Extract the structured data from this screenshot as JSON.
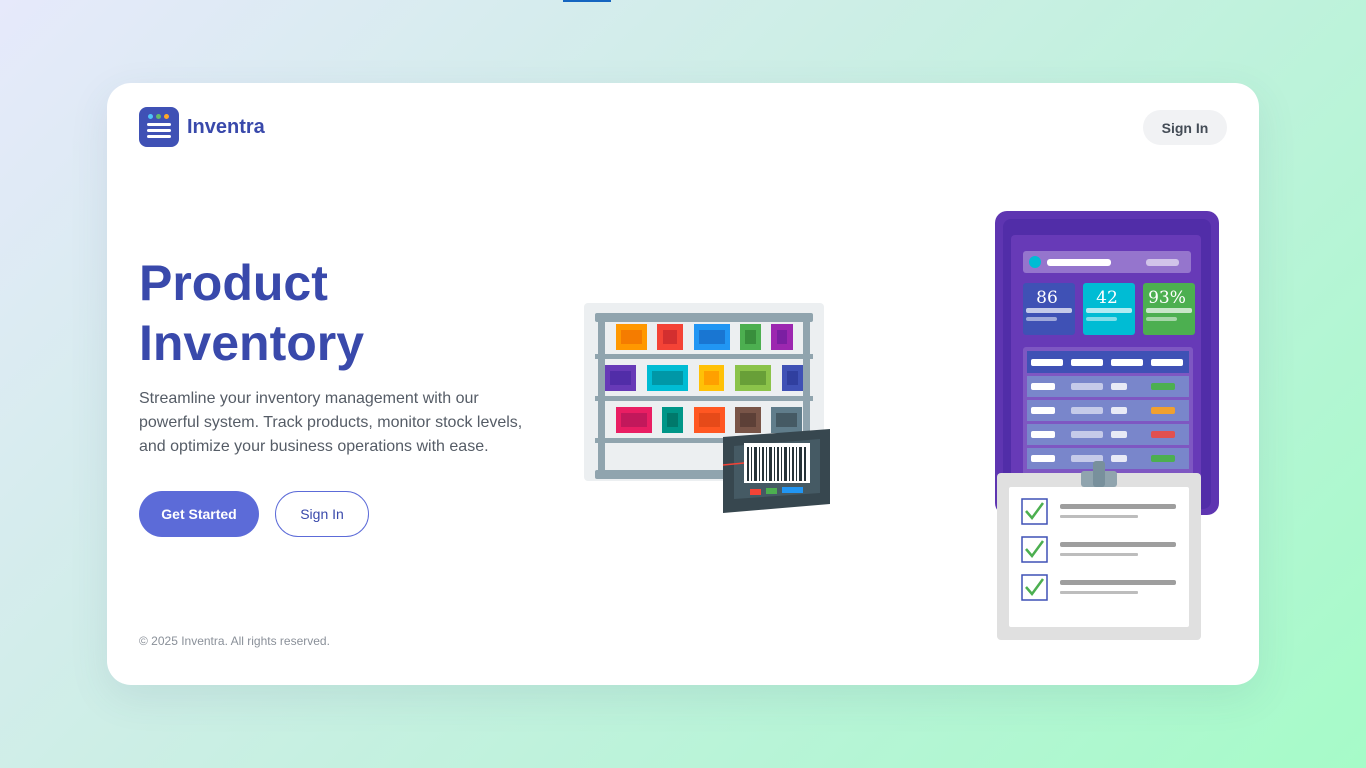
{
  "brand": {
    "name": "Inventra"
  },
  "header": {
    "sign_in_label": "Sign In"
  },
  "hero": {
    "title_line1": "Product",
    "title_line2": "Inventory",
    "description": "Streamline your inventory management with our powerful system. Track products, monitor stock levels, and optimize your business operations with ease.",
    "primary_cta": "Get Started",
    "secondary_cta": "Sign In"
  },
  "dashboard": {
    "stats": [
      {
        "value": "86",
        "color": "#3f51b5"
      },
      {
        "value": "42",
        "color": "#00bcd4"
      },
      {
        "value": "93%",
        "color": "#4caf50"
      }
    ],
    "row_status_colors": [
      "#4caf50",
      "#f0a030",
      "#e05050",
      "#4caf50"
    ]
  },
  "colors": {
    "brand_primary": "#3949ab",
    "button_primary": "#5c6bd8",
    "tablet_purple": "#5e35b1"
  },
  "footer": {
    "copyright": "© 2025 Inventra. All rights reserved."
  }
}
